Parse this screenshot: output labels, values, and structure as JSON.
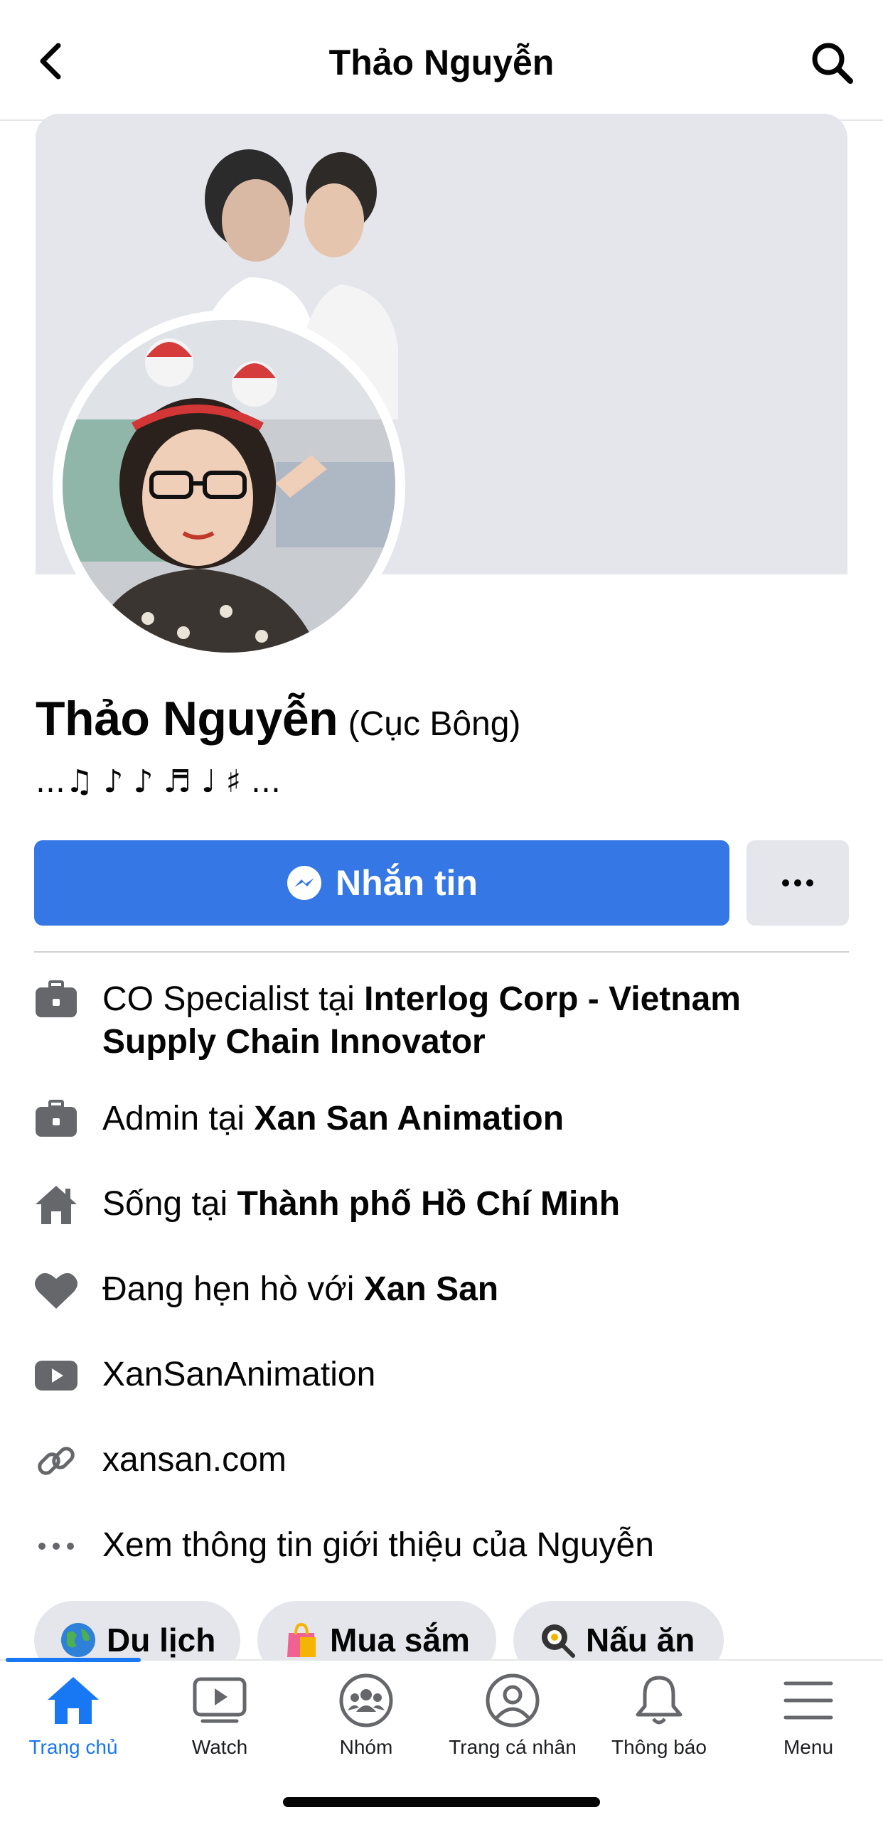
{
  "header": {
    "title": "Thảo Nguyễn"
  },
  "profile": {
    "name": "Thảo Nguyễn",
    "alternate_name": "(Cục Bông)",
    "bio": "...♫ ♪ ♪ ♬ ♩ ♯ ..."
  },
  "actions": {
    "message_label": "Nhắn tin",
    "more_label": "···"
  },
  "intro": [
    {
      "icon": "briefcase-icon",
      "prefix": "CO Specialist tại ",
      "bold": "Interlog Corp - Vietnam Supply Chain Innovator"
    },
    {
      "icon": "briefcase-icon",
      "prefix": "Admin tại ",
      "bold": "Xan San Animation"
    },
    {
      "icon": "home-icon",
      "prefix": "Sống tại ",
      "bold": "Thành phố Hồ Chí Minh"
    },
    {
      "icon": "heart-icon",
      "prefix": "Đang hẹn hò với ",
      "bold": "Xan San"
    },
    {
      "icon": "youtube-icon",
      "prefix": "XanSanAnimation",
      "bold": ""
    },
    {
      "icon": "link-icon",
      "prefix": "xansan.com",
      "bold": ""
    },
    {
      "icon": "more-dots-icon",
      "prefix": "Xem thông tin giới thiệu của Nguyễn",
      "bold": ""
    }
  ],
  "interests": [
    {
      "icon": "globe-icon",
      "label": "Du lịch"
    },
    {
      "icon": "shopping-bag-icon",
      "label": "Mua sắm"
    },
    {
      "icon": "frying-pan-icon",
      "label": "Nấu ăn"
    }
  ],
  "tabs": [
    {
      "icon": "home-tab-icon",
      "label": "Trang chủ",
      "active": true
    },
    {
      "icon": "watch-icon",
      "label": "Watch",
      "active": false
    },
    {
      "icon": "groups-icon",
      "label": "Nhóm",
      "active": false
    },
    {
      "icon": "profile-icon",
      "label": "Trang cá nhân",
      "active": false
    },
    {
      "icon": "bell-icon",
      "label": "Thông báo",
      "active": false
    },
    {
      "icon": "menu-icon",
      "label": "Menu",
      "active": false
    }
  ],
  "colors": {
    "primary": "#1877f2",
    "button_blue": "#3578e5",
    "surface_gray": "#e4e6eb",
    "icon_gray": "#65676b"
  }
}
